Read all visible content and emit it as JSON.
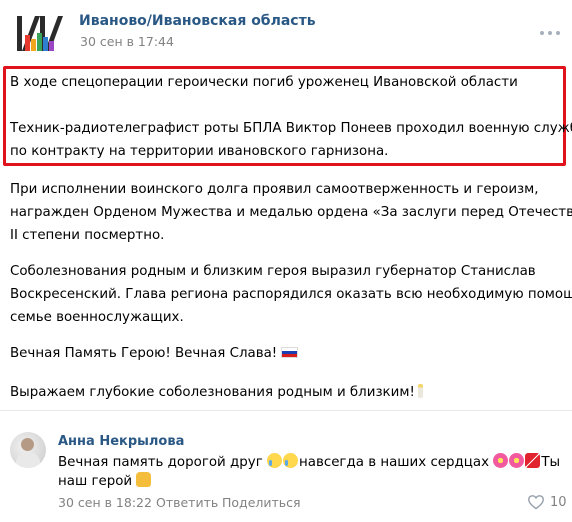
{
  "post": {
    "group_name": "Иваново/Ивановская область",
    "date": "30 сен в 17:44",
    "lines": {
      "l1": "В ходе спецоперации героически погиб уроженец Ивановской области",
      "l2": "Техник-радиотелеграфист роты БПЛА Виктор Понеев проходил военную службу",
      "l3": "по контракту на территории ивановского гарнизона.",
      "l4": "При исполнении воинского долга проявил самоотверженность и героизм,",
      "l5": "награжден Орденом Мужества и медалью ордена «За заслуги перед Отечеством»",
      "l6": "II степени посмертно.",
      "l7": "Соболезнования родным и близким героя выразил губернатор Станислав",
      "l8": "Воскресенский. Глава региона распорядился оказать всю необходимую помощь",
      "l9": "семье военнослужащих.",
      "l10": "Вечная Память Герою! Вечная Слава!",
      "l11": "Выражаем глубокие соболезнования родным и близким!"
    },
    "emoji": {
      "flag": "russian-flag-icon",
      "candle": "candle-icon"
    },
    "highlight_color": "#e0121b",
    "link_color": "#2a5885"
  },
  "comment": {
    "author": "Анна Некрылова",
    "text_part1": "Вечная память дорогой друг ",
    "text_part2": "навсегда в наших сердцах ",
    "text_part3": "Ты",
    "text_line2": "наш герой ",
    "date": "30 сен в 18:22",
    "reply_label": "Ответить",
    "share_label": "Поделиться",
    "likes": "10"
  }
}
